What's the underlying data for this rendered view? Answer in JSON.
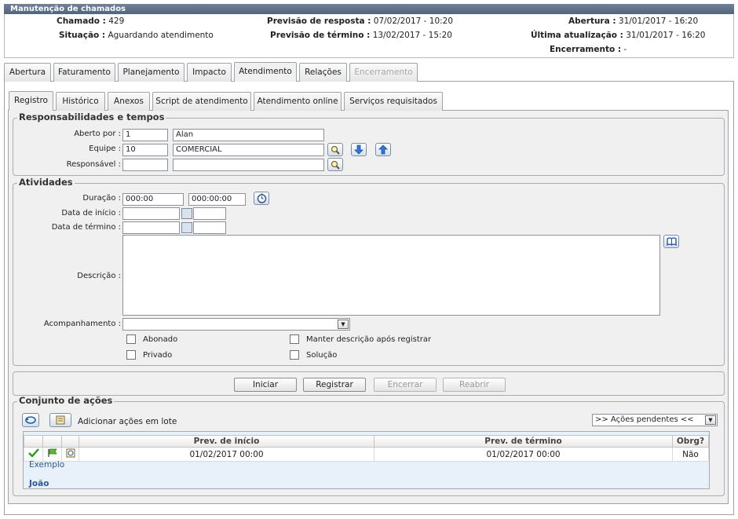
{
  "window": {
    "title": "Manutenção de chamados"
  },
  "header": {
    "chamado_label": "Chamado :",
    "chamado_value": "429",
    "situacao_label": "Situação :",
    "situacao_value": "Aguardando atendimento",
    "prev_resposta_label": "Previsão de resposta :",
    "prev_resposta_value": "07/02/2017 - 10:20",
    "prev_termino_label": "Previsão de término :",
    "prev_termino_value": "13/02/2017 - 15:20",
    "abertura_label": "Abertura :",
    "abertura_value": "31/01/2017 - 16:20",
    "ultima_label": "Última atualização :",
    "ultima_value": "31/01/2017 - 16:20",
    "encerramento_label": "Encerramento :",
    "encerramento_value": "-"
  },
  "main_tabs": [
    "Abertura",
    "Faturamento",
    "Planejamento",
    "Impacto",
    "Atendimento",
    "Relações",
    "Encerramento"
  ],
  "sub_tabs": [
    "Registro",
    "Histórico",
    "Anexos",
    "Script de atendimento",
    "Atendimento online",
    "Serviços requisitados"
  ],
  "responsabilidades": {
    "legend": "Responsabilidades e tempos",
    "aberto_por_label": "Aberto por :",
    "aberto_por_code": "1",
    "aberto_por_name": "Alan",
    "equipe_label": "Equipe :",
    "equipe_code": "10",
    "equipe_name": "COMERCIAL",
    "responsavel_label": "Responsável :",
    "responsavel_code": "",
    "responsavel_name": ""
  },
  "atividades": {
    "legend": "Atividades",
    "duracao_label": "Duração :",
    "duracao_value1": "000:00",
    "duracao_value2": "000:00:00",
    "data_inicio_label": "Data de início :",
    "data_inicio_date": "",
    "data_inicio_time": "",
    "data_termino_label": "Data de término :",
    "data_termino_date": "",
    "data_termino_time": "",
    "descricao_label": "Descrição :",
    "descricao_value": "",
    "acompanhamento_label": "Acompanhamento :",
    "acompanhamento_value": "",
    "abonado_label": "Abonado",
    "privado_label": "Privado",
    "manter_label": "Manter descrição após registrar",
    "solucao_label": "Solução"
  },
  "action_buttons": {
    "iniciar": "Iniciar",
    "registrar": "Registrar",
    "encerrar": "Encerrar",
    "reabrir": "Reabrir"
  },
  "conjunto": {
    "legend": "Conjunto de ações",
    "adicionar_lote": "Adicionar ações em lote",
    "filter_value": ">> Ações pendentes <<",
    "columns": [
      "Prev. de início",
      "Prev. de término",
      "Obrg?"
    ],
    "rows": [
      {
        "prev_inicio": "01/02/2017 00:00",
        "prev_termino": "01/02/2017 00:00",
        "obrg": "Não",
        "name": "Exemplo",
        "user": "João"
      }
    ]
  },
  "colors": {
    "title_bar": "#5d6f86",
    "link_blue": "#2a5a9a",
    "panel_bg": "#f0f0f0",
    "check_green": "#2a9a1a"
  }
}
